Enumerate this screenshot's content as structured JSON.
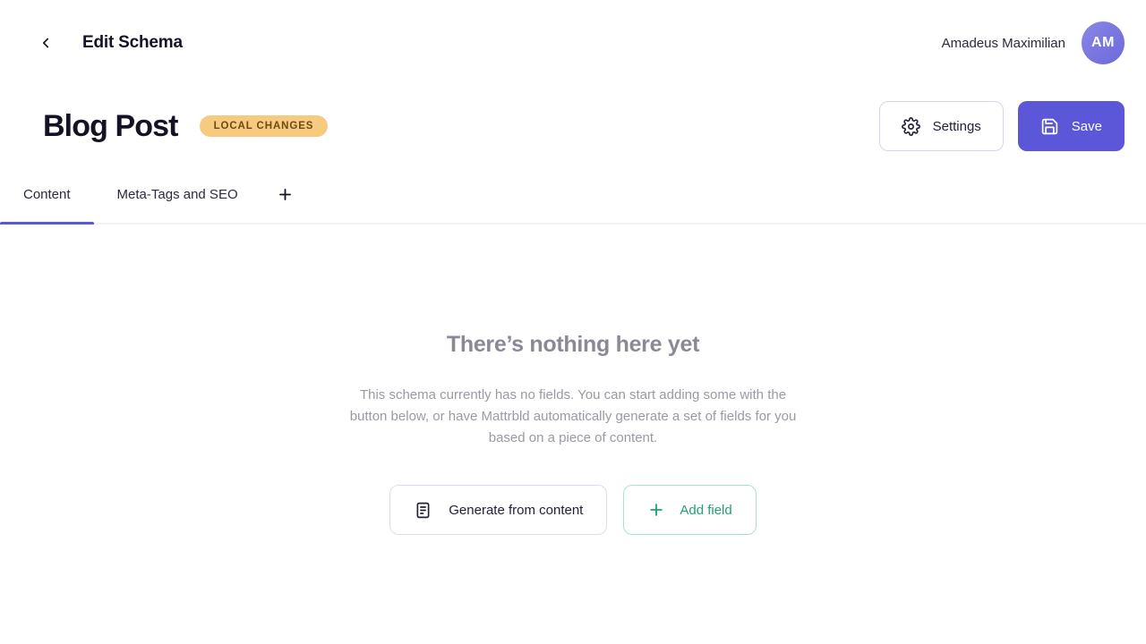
{
  "topbar": {
    "back_icon": "chevron-left-icon",
    "title": "Edit Schema",
    "user_name": "Amadeus Maximilian",
    "avatar_initials": "AM",
    "avatar_gradient_from": "#8b8ae6",
    "avatar_gradient_to": "#6e6bdd"
  },
  "title_row": {
    "schema_name": "Blog Post",
    "badge_label": "Local changes",
    "badge_bg": "#f7cb7f",
    "badge_color": "#6b4a14",
    "settings_label": "Settings",
    "settings_icon": "gear-icon",
    "save_label": "Save",
    "save_icon": "floppy-disk-icon",
    "save_bg": "#5b57d8"
  },
  "tabs": {
    "items": [
      {
        "label": "Content",
        "active": true
      },
      {
        "label": "Meta-Tags and SEO",
        "active": false
      }
    ],
    "add_tab_icon": "plus-icon",
    "active_underline_color": "#5b57d8"
  },
  "empty_state": {
    "title": "There’s nothing here yet",
    "description": "This schema currently has no fields. You can start adding some with the button below, or have Mattrbld automatically generate a set of fields for you based on a piece of content.",
    "generate_label": "Generate from content",
    "generate_icon": "document-text-icon",
    "add_field_label": "Add field",
    "add_field_icon": "plus-icon",
    "add_field_color": "#22a07a"
  }
}
